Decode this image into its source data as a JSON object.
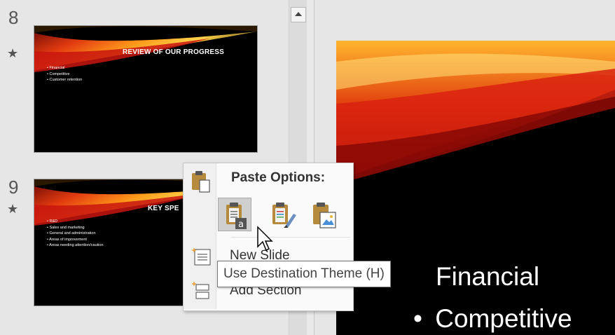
{
  "thumbnails": [
    {
      "number": "8",
      "star": "★",
      "title": "REVIEW OF OUR PROGRESS",
      "bullets": [
        "Financial",
        "Competitive",
        "Customer retention"
      ]
    },
    {
      "number": "9",
      "star": "★",
      "title": "KEY SPE",
      "bullets": [
        "R&D",
        "Sales and marketing",
        "General and administration",
        "Areas of improvement",
        "Areas needing attention/caution"
      ]
    }
  ],
  "main_slide": {
    "bullets": [
      "Financial",
      "Competitive"
    ]
  },
  "context_menu": {
    "paste_header": "Paste Options:",
    "paste_options": [
      "clipboard-destination-theme-icon",
      "clipboard-keep-formatting-icon",
      "clipboard-picture-icon"
    ],
    "items": [
      {
        "label": "New Slide",
        "icon": "new-slide-icon"
      },
      {
        "label": "Add Section",
        "icon": "add-section-icon"
      }
    ]
  },
  "tooltip": "Use Destination Theme (H)",
  "colors": {
    "pane": "#e6e6e6",
    "menu_bg": "#fafafa",
    "selected": "#cfcfcf",
    "slide_bg": "#000000",
    "clip_brown": "#b58a3c"
  }
}
